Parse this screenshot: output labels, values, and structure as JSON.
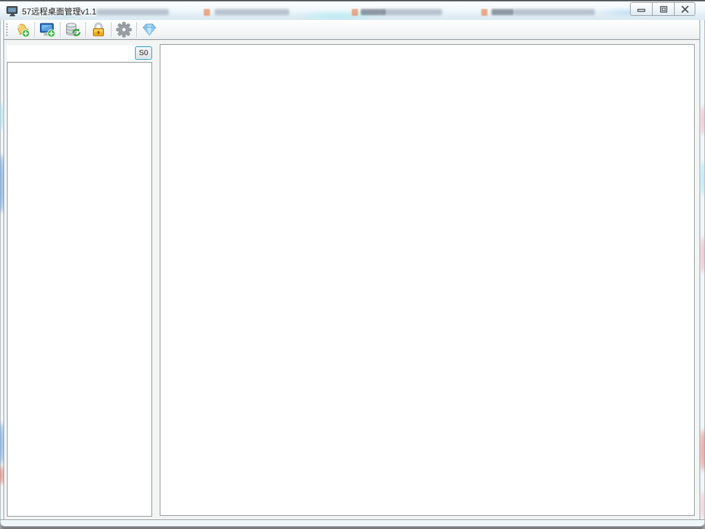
{
  "window": {
    "title": "57远程桌面管理v1.1",
    "app_icon": "monitor-icon",
    "controls": [
      {
        "name": "minimize",
        "icon": "minimize-icon"
      },
      {
        "name": "maximize",
        "icon": "maximize-icon"
      },
      {
        "name": "close",
        "icon": "close-icon"
      }
    ]
  },
  "toolbar": {
    "buttons": [
      {
        "name": "add-group",
        "icon": "bell-plus-icon"
      },
      {
        "name": "add-computer",
        "icon": "monitor-plus-icon"
      },
      {
        "name": "refresh-data",
        "icon": "database-refresh-icon"
      },
      {
        "name": "lock",
        "icon": "padlock-icon"
      },
      {
        "name": "settings",
        "icon": "gear-icon"
      },
      {
        "name": "about",
        "icon": "diamond-icon"
      }
    ]
  },
  "sidebar": {
    "filter_button": {
      "label": "S0"
    }
  },
  "colors": {
    "titlebar_glass": "#eaf6fa",
    "toolbar_border": "#8a9095",
    "panel_border": "#8f969c",
    "accent_button_border": "#41a3c4",
    "badge_green": "#2eb135",
    "lock_gold": "#f0a818",
    "diamond_blue": "#a8d8f5"
  }
}
